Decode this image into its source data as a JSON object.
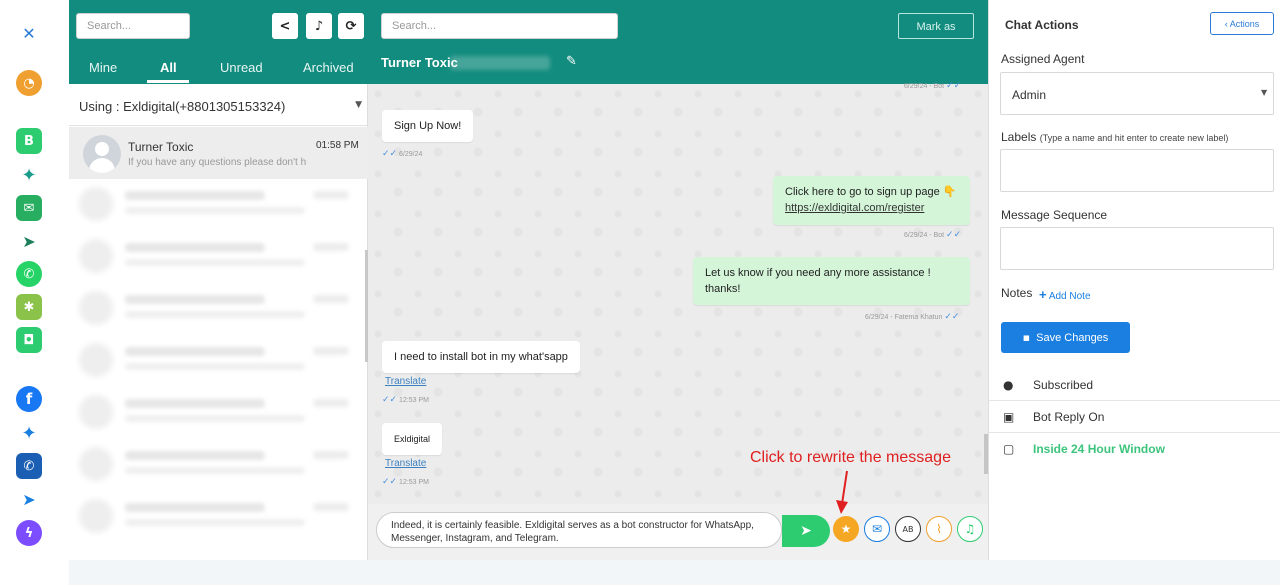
{
  "rail": {
    "icons": [
      "logo-icon",
      "dashboard-gauge-icon",
      "b-icon",
      "robot-icon",
      "whatsapp-card-icon",
      "announcement-icon",
      "whatsapp-icon",
      "puzzle-icon",
      "shopping-bag-icon",
      "facebook-icon",
      "bot-icon",
      "phone-card-icon",
      "megaphone-icon",
      "messenger-icon"
    ]
  },
  "list": {
    "search_placeholder": "Search...",
    "tabs": [
      "Mine",
      "All",
      "Unread",
      "Archived"
    ],
    "active_tab": "All",
    "using_label": "Using : Exldigital(+8801305153324)",
    "active_chat": {
      "name": "Turner Toxic",
      "time": "01:58 PM",
      "preview": "If you have any questions please don't h"
    }
  },
  "chat": {
    "search_placeholder": "Search...",
    "mark_as_label": "Mark as",
    "contact_name": "Turner Toxic",
    "messages": [
      {
        "dir": "out",
        "meta": "6/29/24 - Bot"
      },
      {
        "dir": "in",
        "text": "Sign Up Now!",
        "meta": "6/29/24"
      },
      {
        "dir": "out",
        "text": "Click here to go to sign up page 👇",
        "link": "https://exldigital.com/register",
        "meta": "6/29/24 - Bot"
      },
      {
        "dir": "out",
        "text": "Let us know if you need any more assistance ! thanks!",
        "meta": "6/29/24 - Fatema Khatun"
      },
      {
        "dir": "in",
        "text": "I need to install bot in my what'sapp",
        "translate": "Translate",
        "meta": "12:53 PM"
      },
      {
        "dir": "in",
        "text": "Exldigital",
        "translate": "Translate",
        "meta": "12:53 PM"
      }
    ],
    "composer_text": "Indeed, it is certainly feasible. Exldigital serves as a bot constructor for WhatsApp, Messenger, Instagram, and Telegram.",
    "annotation": "Click to rewrite the message",
    "accent": "#128c7e"
  },
  "right": {
    "title": "Chat Actions",
    "actions_label": "‹ Actions",
    "assigned_agent_label": "Assigned Agent",
    "assigned_agent_value": "Admin",
    "labels_label": "Labels",
    "labels_hint": "(Type a name and hit enter to create new label)",
    "message_sequence_label": "Message Sequence",
    "notes_label": "Notes",
    "add_note_label": "Add Note",
    "save_label": "Save Changes",
    "statuses": [
      {
        "icon": "user-icon",
        "text": "Subscribed"
      },
      {
        "icon": "robot-icon",
        "text": "Bot Reply On"
      },
      {
        "icon": "chat-bubble-icon",
        "text": "Inside 24 Hour Window"
      }
    ],
    "window_color": "#3cc47c"
  }
}
